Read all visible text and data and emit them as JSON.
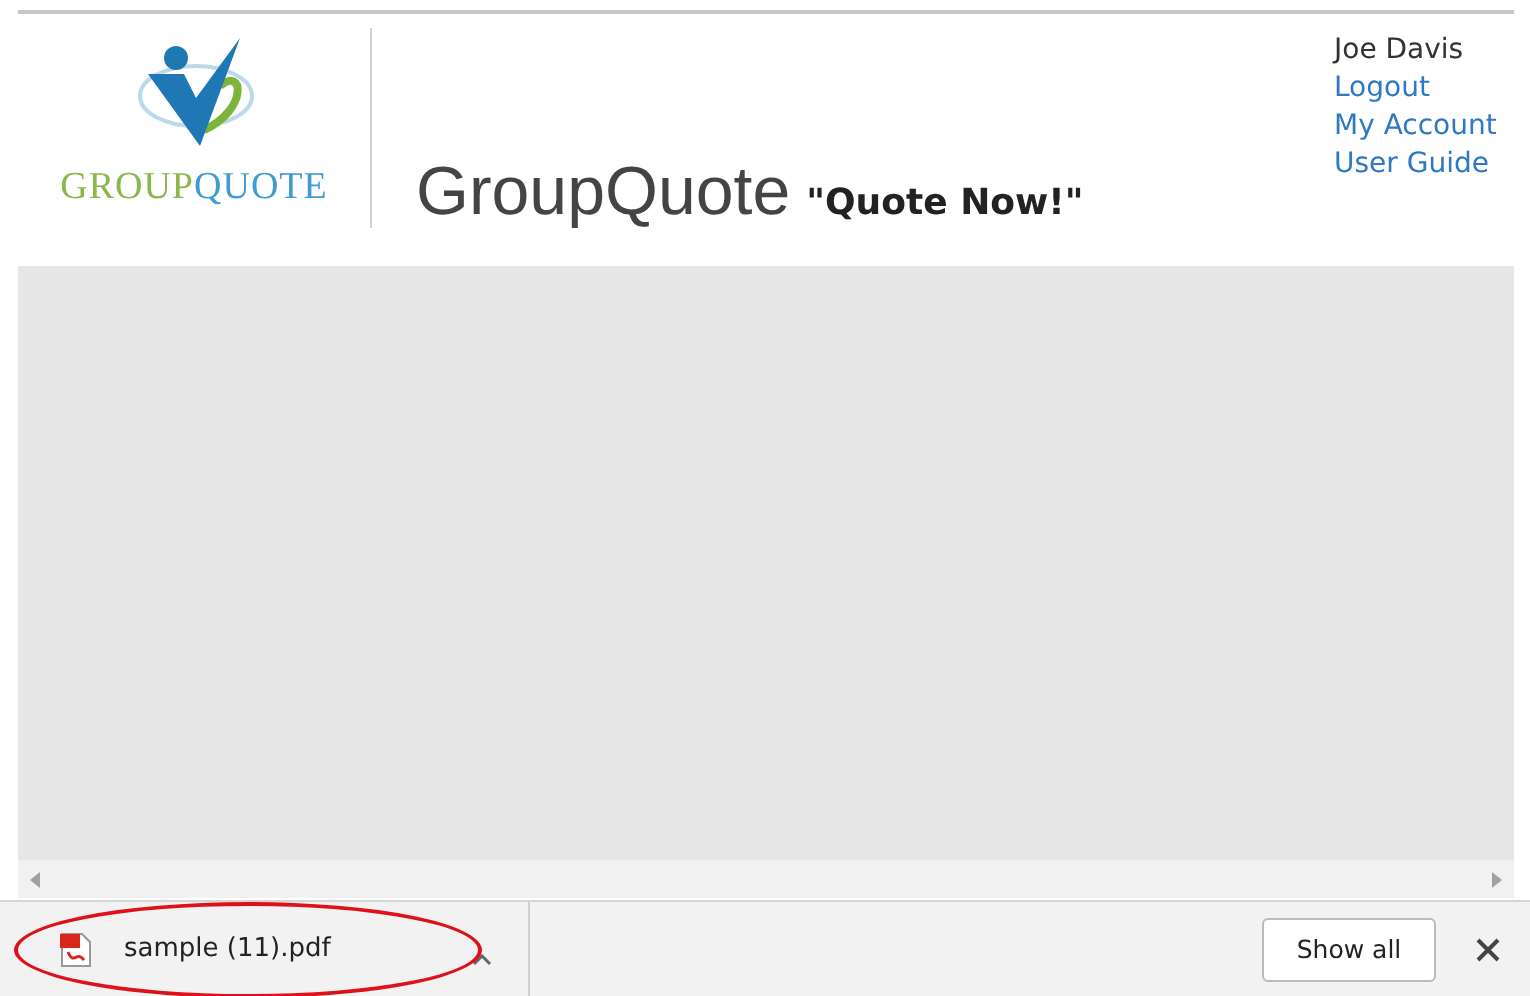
{
  "header": {
    "logo": {
      "word_1": "GROUP",
      "word_2": "QUOTE"
    },
    "title": "GroupQuote",
    "tagline": "\"Quote Now!\"",
    "user_name": "Joe Davis",
    "links": [
      "Logout",
      "My Account",
      "User Guide"
    ]
  },
  "download_bar": {
    "file": {
      "name": "sample (11).pdf",
      "highlighted": true
    },
    "show_all": "Show all"
  }
}
